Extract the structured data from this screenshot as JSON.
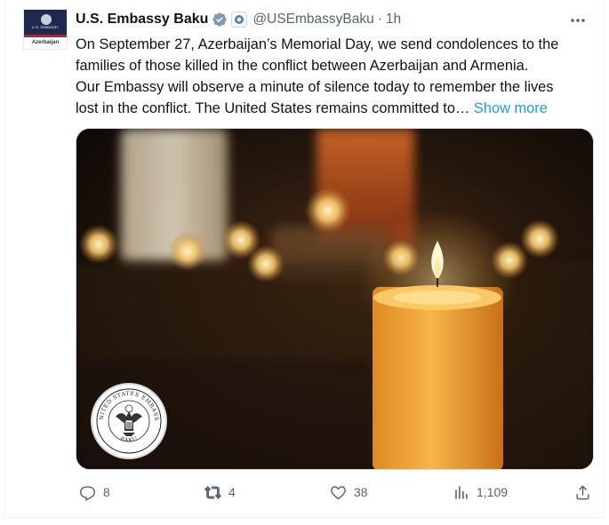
{
  "account": {
    "display_name": "U.S. Embassy Baku",
    "handle": "@USEmbassyBaku",
    "separator": "·",
    "time": "1h",
    "avatar": {
      "top_text": "U.S. EMBASSY",
      "bottom_text": "Azerbaijan"
    },
    "verified_icon": "verified-badge-icon",
    "affiliation_icon": "government-affiliation-icon"
  },
  "tweet": {
    "lines": [
      "On September 27, Azerbaijan’s Memorial Day, we send condolences to the",
      "families of those killed in the conflict between Azerbaijan and Armenia.",
      "Our Embassy will observe a minute of silence today to remember the lives",
      "lost in the conflict.  The United States remains committed to…"
    ],
    "show_more_label": "Show more"
  },
  "media": {
    "seal_top_text": "UNITED STATES EMBASSY",
    "seal_bottom_text": "BAKU"
  },
  "actions": {
    "replies": "8",
    "reposts": "4",
    "likes": "38",
    "views": "1,109"
  },
  "colors": {
    "accent": "#1d9bf0",
    "secondary_text": "#536471",
    "primary_text": "#0f1419"
  }
}
